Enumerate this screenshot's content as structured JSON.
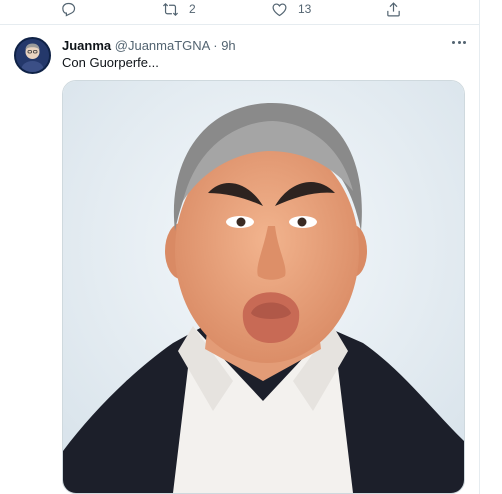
{
  "actions": {
    "reply_count": "",
    "retweet_count": "2",
    "like_count": "13"
  },
  "tweet": {
    "author_name": "Juanma",
    "author_handle": "@JuanmaTGNA",
    "separator": "·",
    "time": "9h",
    "text": "Con Guorperfe..."
  },
  "icons": {
    "reply": "reply-icon",
    "retweet": "retweet-icon",
    "like": "heart-icon",
    "share": "share-icon",
    "more": "more-options-icon"
  },
  "colors": {
    "text_primary": "#0f1419",
    "text_secondary": "#536471",
    "border": "#e6ecf0"
  }
}
